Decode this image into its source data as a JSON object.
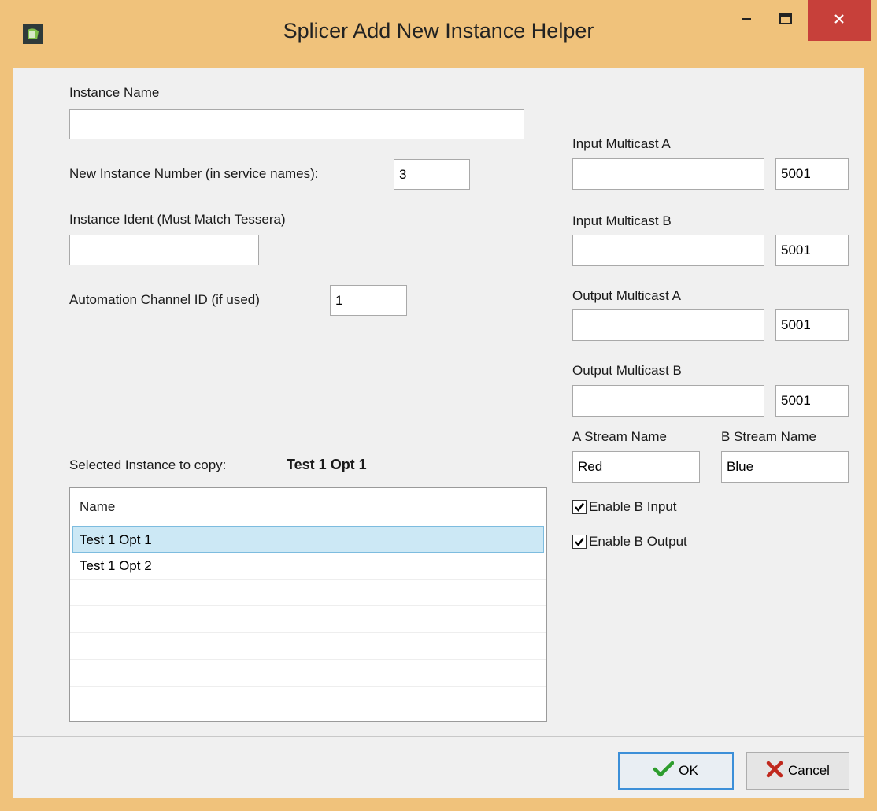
{
  "window": {
    "title": "Splicer Add New Instance Helper"
  },
  "form": {
    "instance_name_label": "Instance Name",
    "instance_name_value": "",
    "instance_number_label": "New Instance Number (in service names):",
    "instance_number_value": "3",
    "instance_ident_label": "Instance Ident (Must Match Tessera)",
    "instance_ident_value": "",
    "automation_label": "Automation Channel ID (if used)",
    "automation_value": "1"
  },
  "multicast": {
    "input_a": {
      "label": "Input Multicast A",
      "address": "",
      "port": "5001"
    },
    "input_b": {
      "label": "Input Multicast B",
      "address": "",
      "port": "5001"
    },
    "output_a": {
      "label": "Output Multicast A",
      "address": "",
      "port": "5001"
    },
    "output_b": {
      "label": "Output Multicast B",
      "address": "",
      "port": "5001"
    }
  },
  "streams": {
    "a_label": "A Stream Name",
    "a_value": "Red",
    "b_label": "B Stream Name",
    "b_value": "Blue"
  },
  "options": {
    "enable_b_input": {
      "label": "Enable B Input",
      "checked": true
    },
    "enable_b_output": {
      "label": "Enable B Output",
      "checked": true
    }
  },
  "copy": {
    "label": "Selected Instance to copy:",
    "selected": "Test 1 Opt 1",
    "column_header": "Name",
    "rows": [
      "Test 1 Opt 1",
      "Test 1 Opt 2"
    ]
  },
  "buttons": {
    "ok": "OK",
    "cancel": "Cancel"
  },
  "colors": {
    "titlebar": "#f0c27b",
    "close": "#c7403a",
    "selection": "#cce8f5",
    "ok_check": "#2e9d2e",
    "cancel_x": "#c0281d"
  }
}
